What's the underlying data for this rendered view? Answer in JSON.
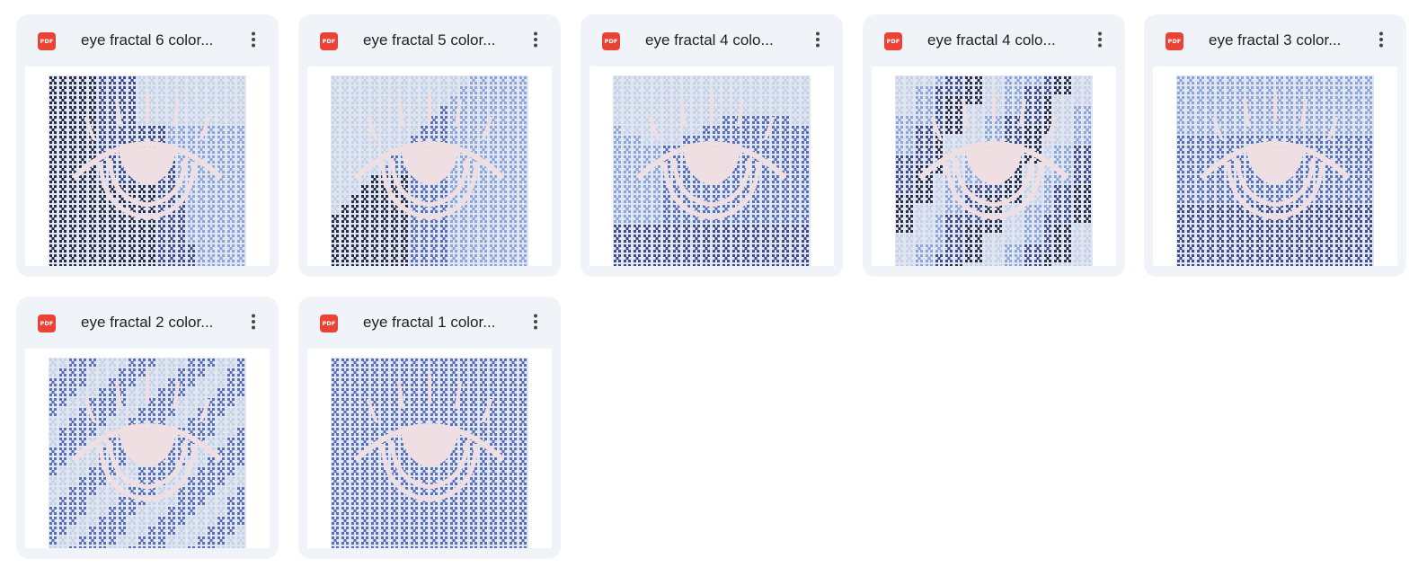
{
  "files": [
    {
      "title": "eye fractal 6 color...",
      "file_type": "PDF",
      "style": "v6",
      "menu_icon": "more-vert-icon"
    },
    {
      "title": "eye fractal 5 color...",
      "file_type": "PDF",
      "style": "v5",
      "menu_icon": "more-vert-icon"
    },
    {
      "title": "eye fractal 4 colo...",
      "file_type": "PDF",
      "style": "v4a",
      "menu_icon": "more-vert-icon"
    },
    {
      "title": "eye fractal 4 colo...",
      "file_type": "PDF",
      "style": "v4b",
      "menu_icon": "more-vert-icon"
    },
    {
      "title": "eye fractal 3 color...",
      "file_type": "PDF",
      "style": "v3",
      "menu_icon": "more-vert-icon"
    },
    {
      "title": "eye fractal 2 color...",
      "file_type": "PDF",
      "style": "v2",
      "menu_icon": "more-vert-icon"
    },
    {
      "title": "eye fractal 1 color...",
      "file_type": "PDF",
      "style": "v1",
      "menu_icon": "more-vert-icon"
    }
  ],
  "colors": {
    "card_background": "#f0f4f9",
    "pdf_icon": "#ea4335",
    "title_text": "#1f1f1f",
    "pattern_dark": "#2a2b45",
    "pattern_navy": "#3f4a8a",
    "pattern_blue": "#5a6db8",
    "pattern_light": "#8da4da",
    "pattern_pale": "#c7d1e6",
    "eye_pink": "#efdfe2"
  }
}
